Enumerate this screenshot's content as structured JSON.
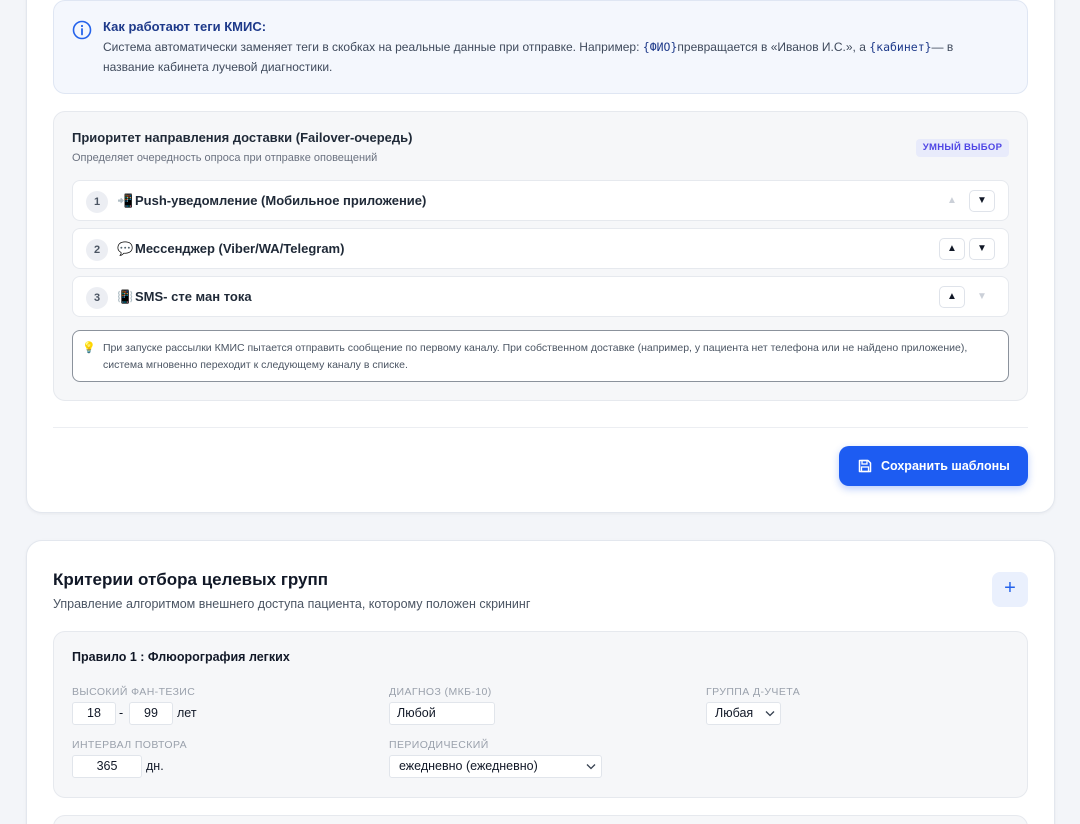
{
  "info": {
    "title": "Как работают теги КМИС:",
    "text_1": "Система автоматически заменяет теги в скобках на реальные данные при отправке. Например: ",
    "tag_1": "{ФИО}",
    "text_2": "превращается в «Иванов И.С.», а ",
    "tag_2": "{кабинет}",
    "text_3": "— в название кабинета лучевой диагностики."
  },
  "priority": {
    "title": "Приоритет направления доставки (Failover-очередь)",
    "subtitle": "Определяет очередность опроса при отправке оповещений",
    "badge": "УМНЫЙ ВЫБОР",
    "channels": [
      {
        "num": "1",
        "emoji": "📲",
        "label": "Push-уведомление (Мобильное приложение)",
        "up": "▲",
        "down": "▼"
      },
      {
        "num": "2",
        "emoji": "💬",
        "label": "Мессенджер (Viber/WA/Telegram)",
        "up": "▲",
        "down": "▼"
      },
      {
        "num": "3",
        "emoji": "📳",
        "label": "SMS- сте ман тока",
        "up": "▲",
        "down": "▼"
      }
    ],
    "note_icon": "💡",
    "note": "При запуске рассылки КМИС пытается отправить сообщение по первому каналу. При собственном доставке (например, у пациента нет телефона или не найдено приложение), система мгновенно переходит к следующему каналу в списке."
  },
  "save_button": "Сохранить шаблоны",
  "criteria": {
    "title": "Критерии отбора целевых групп",
    "subtitle": "Управление алгоритмом внешнего доступа пациента, которому положен скрининг",
    "add_label": "+",
    "rule": {
      "title": "Правило 1 : Флюорография легких",
      "age_label": "ВЫСОКИЙ ФАН-ТЕЗИС",
      "age_from": "18",
      "age_sep": "-",
      "age_to": "99",
      "age_unit": "лет",
      "diagnosis_label": "ДИАГНОЗ (МКБ-10)",
      "diagnosis_value": "Любой",
      "group_label": "ГРУППА Д-УЧЕТА",
      "group_value": "Любая",
      "interval_label": "ИНТЕРВАЛ ПОВТОРА",
      "interval_value": "365",
      "interval_unit": "дн.",
      "periodic_label": "ПЕРИОДИЧЕСКИЙ",
      "periodic_value": "ежедневно (ежедневно)"
    }
  },
  "colors": {
    "accent": "#1d5cf2",
    "badge_text": "#4f46e5",
    "info_title": "#1e3a8a"
  },
  "icons": [
    "info-icon",
    "mobile-icon",
    "chat-icon",
    "vibrate-icon",
    "lightbulb-icon",
    "save-icon",
    "plus-icon",
    "chevron-down-icon"
  ]
}
